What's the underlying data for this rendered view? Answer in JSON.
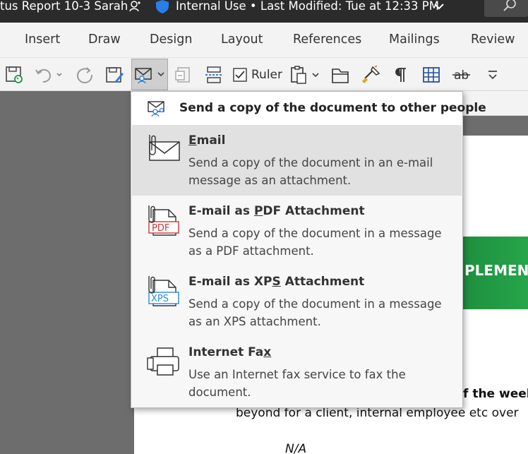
{
  "titlebar": {
    "doc_title": "tus Report 10-3 Sarah",
    "sensitivity": "Internal Use • Last Modified: Tue at 12:33 PM"
  },
  "tabs": [
    "Insert",
    "Draw",
    "Design",
    "Layout",
    "References",
    "Mailings",
    "Review"
  ],
  "toolbar": {
    "ruler_label": "Ruler",
    "icons": [
      "save-sync-icon",
      "undo-icon",
      "redo-icon",
      "save-as-icon",
      "email-send-icon",
      "spelling-icon",
      "page-break-icon",
      "ruler-checkbox-icon",
      "paste-icon",
      "open-icon",
      "format-painter-icon",
      "pilcrow-icon",
      "table-icon",
      "strikethrough-icon",
      "customize-icon"
    ]
  },
  "menu": {
    "header": "Send a copy of the document to other people",
    "items": [
      {
        "title_pre": "",
        "title_key": "E",
        "title_post": "mail",
        "desc": "Send a copy of the document in an e-mail message as an attachment.",
        "icon": "email-attachment-icon"
      },
      {
        "title_pre": "E-mail as ",
        "title_key": "P",
        "title_post": "DF Attachment",
        "desc": "Send a copy of the document in a message as a PDF attachment.",
        "icon": "pdf-attachment-icon",
        "badge": "PDF"
      },
      {
        "title_pre": "E-mail as XP",
        "title_key": "S",
        "title_post": " Attachment",
        "desc": "Send a copy of the document in a message as an XPS attachment.",
        "icon": "xps-attachment-icon",
        "badge": "XPS"
      },
      {
        "title_pre": "Internet Fa",
        "title_key": "x",
        "title_post": "",
        "desc": "Use an Internet fax service to fax the document.",
        "icon": "fax-icon"
      }
    ]
  },
  "document": {
    "banner_text": "PLEMEN",
    "line1": "f the week:",
    "line2": "beyond for a client, internal employee etc over",
    "line3": "N/A"
  },
  "colors": {
    "titlebar": "#2b2b2b",
    "ribbon": "#f3f3f3",
    "banner_green": "#1e8f3f",
    "pdf_red": "#d13438",
    "xps_blue": "#2b88d8",
    "shield_blue": "#2b7de9"
  }
}
